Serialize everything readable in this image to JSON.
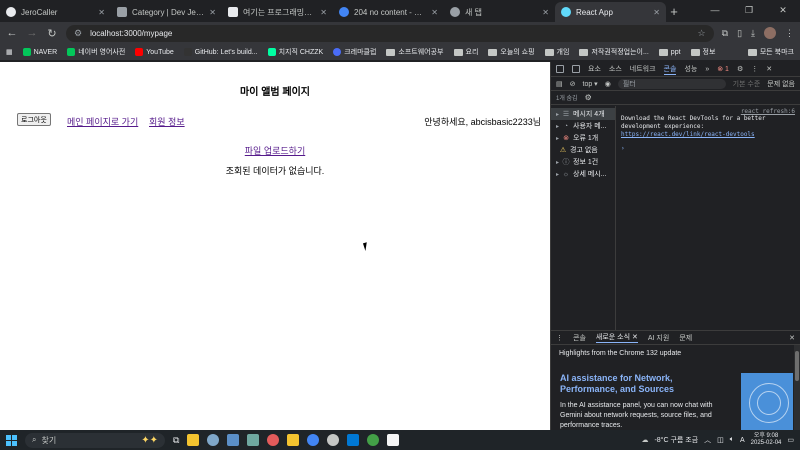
{
  "browser": {
    "tabs": [
      {
        "label": "JeroCaller",
        "active": false
      },
      {
        "label": "Category | Dev Jero on...",
        "active": false
      },
      {
        "label": "여기는 프로그래밍에 대한...",
        "active": false
      },
      {
        "label": "204 no content - Google...",
        "active": false
      },
      {
        "label": "새 탭",
        "active": false
      },
      {
        "label": "React App",
        "active": true
      }
    ],
    "url": "localhost:3000/mypage",
    "bookmarks": [
      "NAVER",
      "네이버 영어사전",
      "YouTube",
      "GitHub: Let's build...",
      "치지직 CHZZK",
      "크레마클럽",
      "소프트웨어공부",
      "요리",
      "오늘의 쇼핑",
      "개임",
      "저작권적정업는이...",
      "ppt",
      "정보"
    ],
    "bookmarks_right": "모든 북마크"
  },
  "page": {
    "title": "마이 앨범 페이지",
    "logout": "로그아웃",
    "main_link": "메인 페이지로 가기",
    "info_link": "회원 정보",
    "greeting": "안녕하세요, abcisbasic2233님",
    "upload_link": "파일 업로드하기",
    "empty_message": "조회된 데이터가 없습니다."
  },
  "devtools": {
    "tabs": [
      "요소",
      "소스",
      "네트워크",
      "콘솔",
      "성능"
    ],
    "error_count": "1",
    "context": "top",
    "filter_placeholder": "필터",
    "level": "기본 수준",
    "issues": "문제 없음",
    "hidden": "1개 숨김",
    "sidebar": [
      {
        "label": "메시지 4개",
        "icon": "list-icon"
      },
      {
        "label": "사용자 메...",
        "icon": "user-icon"
      },
      {
        "label": "오류 1개",
        "icon": "error-icon"
      },
      {
        "label": "경고 없음",
        "icon": "warning-icon"
      },
      {
        "label": "정보 1건",
        "icon": "info-icon"
      },
      {
        "label": "상세 메시...",
        "icon": "bug-icon"
      }
    ],
    "source_link": "react_refresh:6",
    "message_1": "Download the React DevTools for a better",
    "message_2": "development experience:",
    "message_url": "https://react.dev/link/react-devtools",
    "drawer_tabs": [
      "콘솔",
      "새로운 소식",
      "AI 지원"
    ],
    "drawer_issues": "문제",
    "highlights": "Highlights from the Chrome 132 update",
    "ai_title": "AI assistance for Network, Performance, and Sources",
    "ai_desc": "In the AI assistance panel, you can now chat with Gemini about network requests, source files, and performance traces."
  },
  "taskbar": {
    "search": "찾기",
    "weather": "-8°C 구름 조금",
    "time": "오후 9:08",
    "date": "2025-02-04"
  }
}
